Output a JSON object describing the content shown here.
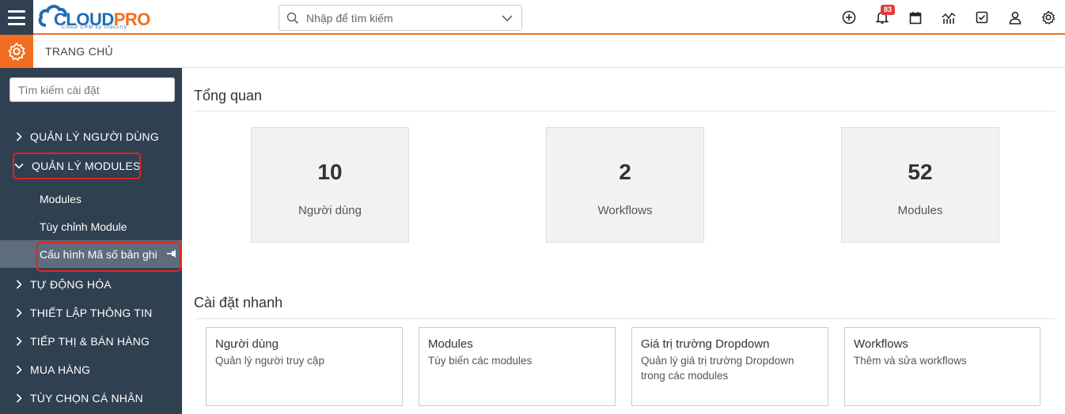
{
  "header": {
    "logo_cloud": "CLOUD",
    "logo_pro": "PRO",
    "logo_sub": "Cloud CRM by Industry",
    "search_placeholder": "Nhập để tìm kiếm",
    "notification_count": "83",
    "icons": [
      "hamburger-menu-icon",
      "search-icon",
      "chevron-down-icon",
      "plus-circle-icon",
      "bell-icon",
      "calendar-icon",
      "chart-icon",
      "checkbox-icon",
      "user-icon",
      "gear-icon"
    ]
  },
  "breadcrumb": {
    "title": "TRANG CHỦ"
  },
  "sidebar": {
    "search_placeholder": "Tìm kiếm cài đặt",
    "items": [
      {
        "label": "QUẢN LÝ NGƯỜI DÙNG",
        "expanded": false
      },
      {
        "label": "QUẢN LÝ MODULES",
        "expanded": true
      },
      {
        "label": "TỰ ĐỘNG HÓA",
        "expanded": false
      },
      {
        "label": "THIẾT LẬP THÔNG TIN",
        "expanded": false
      },
      {
        "label": "TIẾP THỊ & BÁN HÀNG",
        "expanded": false
      },
      {
        "label": "MUA HÀNG",
        "expanded": false
      },
      {
        "label": "TÙY CHỌN CÁ NHÂN",
        "expanded": false
      }
    ],
    "subitems": [
      {
        "label": "Modules"
      },
      {
        "label": "Tùy chỉnh Module"
      },
      {
        "label": "Cấu hình Mã số bản ghi",
        "active": true
      }
    ]
  },
  "overview": {
    "title": "Tổng quan",
    "stats": [
      {
        "value": "10",
        "label": "Người dùng"
      },
      {
        "value": "2",
        "label": "Workflows"
      },
      {
        "value": "52",
        "label": "Modules"
      }
    ]
  },
  "quick": {
    "title": "Cài đặt nhanh",
    "cards": [
      {
        "title": "Người dùng",
        "desc": "Quản lý người truy cập"
      },
      {
        "title": "Modules",
        "desc": "Tùy biến các modules"
      },
      {
        "title": "Giá trị trường Dropdown",
        "desc": "Quản lý giá trị trường Dropdown trong các modules"
      },
      {
        "title": "Workflows",
        "desc": "Thêm và sửa workflows"
      }
    ]
  },
  "colors": {
    "accent": "#f36d21",
    "sidebar": "#2f4050",
    "active": "#5d6d7c",
    "highlight": "#e02424",
    "brand_blue": "#1f6db5"
  }
}
